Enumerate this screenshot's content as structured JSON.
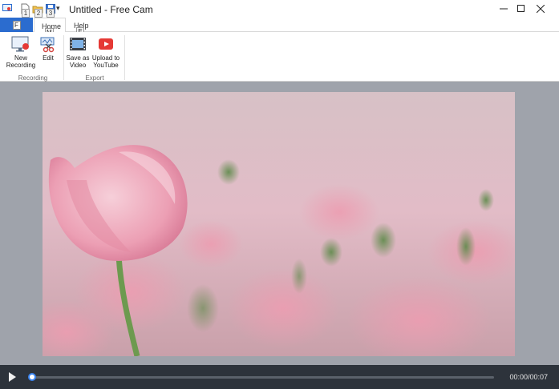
{
  "window": {
    "title": "Untitled - Free Cam",
    "qat_keytips": [
      "1",
      "2",
      "3"
    ]
  },
  "tabs": {
    "file_keytip": "F",
    "home_label": "Home",
    "home_keytip": "M",
    "help_label": "Help",
    "help_keytip": "E"
  },
  "ribbon": {
    "groups": [
      {
        "label": "Recording",
        "buttons": [
          {
            "label_line1": "New",
            "label_line2": "Recording",
            "icon": "new-recording-icon"
          },
          {
            "label_line1": "Edit",
            "label_line2": "",
            "icon": "edit-scissors-icon"
          }
        ]
      },
      {
        "label": "Export",
        "buttons": [
          {
            "label_line1": "Save as",
            "label_line2": "Video",
            "icon": "film-save-icon"
          },
          {
            "label_line1": "Upload to",
            "label_line2": "YouTube",
            "icon": "youtube-icon"
          }
        ]
      }
    ]
  },
  "player": {
    "time": "00:00/00:07",
    "progress_fraction": 0.0
  },
  "colors": {
    "accent": "#2b6ccf",
    "workspace": "#9fa3ab",
    "player_bg": "#2d333b",
    "youtube_red": "#e53935"
  }
}
